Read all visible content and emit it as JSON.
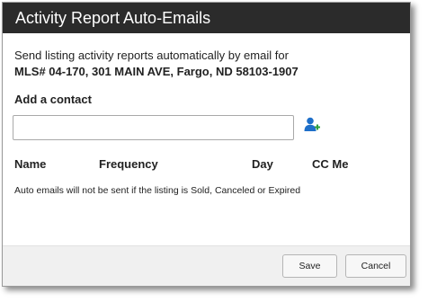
{
  "dialog": {
    "title": "Activity Report Auto-Emails",
    "intro": "Send listing activity reports automatically by email for",
    "listing": "MLS# 04-170, 301 MAIN AVE, Fargo, ND 58103-1907",
    "add_contact_label": "Add a contact",
    "contact_input": {
      "value": "",
      "placeholder": ""
    },
    "add_contact_icon": "add-user-icon",
    "columns": [
      "Name",
      "Frequency",
      "Day",
      "CC Me"
    ],
    "note": "Auto emails will not be sent if the listing is Sold, Canceled or Expired",
    "buttons": {
      "save": "Save",
      "cancel": "Cancel"
    }
  },
  "colors": {
    "titlebar_bg": "#2b2b2b",
    "title_text": "#ffffff",
    "icon_accent": "#1e6fc9",
    "footer_bg": "#f0f0f0"
  }
}
